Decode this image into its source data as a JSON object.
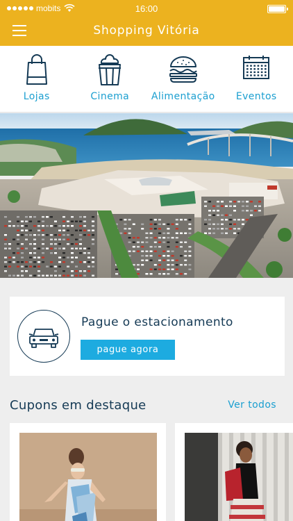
{
  "status_bar": {
    "carrier": "mobits",
    "time": "16:00",
    "signal_bars": 5,
    "battery_level": 1.0
  },
  "nav": {
    "title": "Shopping Vitória",
    "menu_icon": "hamburger-menu-icon"
  },
  "categories": [
    {
      "label": "Lojas",
      "icon": "shopping-bag-icon"
    },
    {
      "label": "Cinema",
      "icon": "popcorn-icon"
    },
    {
      "label": "Alimentação",
      "icon": "burger-icon"
    },
    {
      "label": "Eventos",
      "icon": "calendar-icon"
    }
  ],
  "hero": {
    "image": "aerial-mall-photo"
  },
  "parking": {
    "title": "Pague o estacionamento",
    "button": "pague agora",
    "icon": "car-icon"
  },
  "coupons": {
    "title": "Cupons em destaque",
    "see_all": "Ver todos"
  },
  "colors": {
    "header": "#ecb21f",
    "accent": "#1b9fd0",
    "button": "#1dabe0",
    "navy": "#153a55",
    "background": "#eeeeee"
  }
}
